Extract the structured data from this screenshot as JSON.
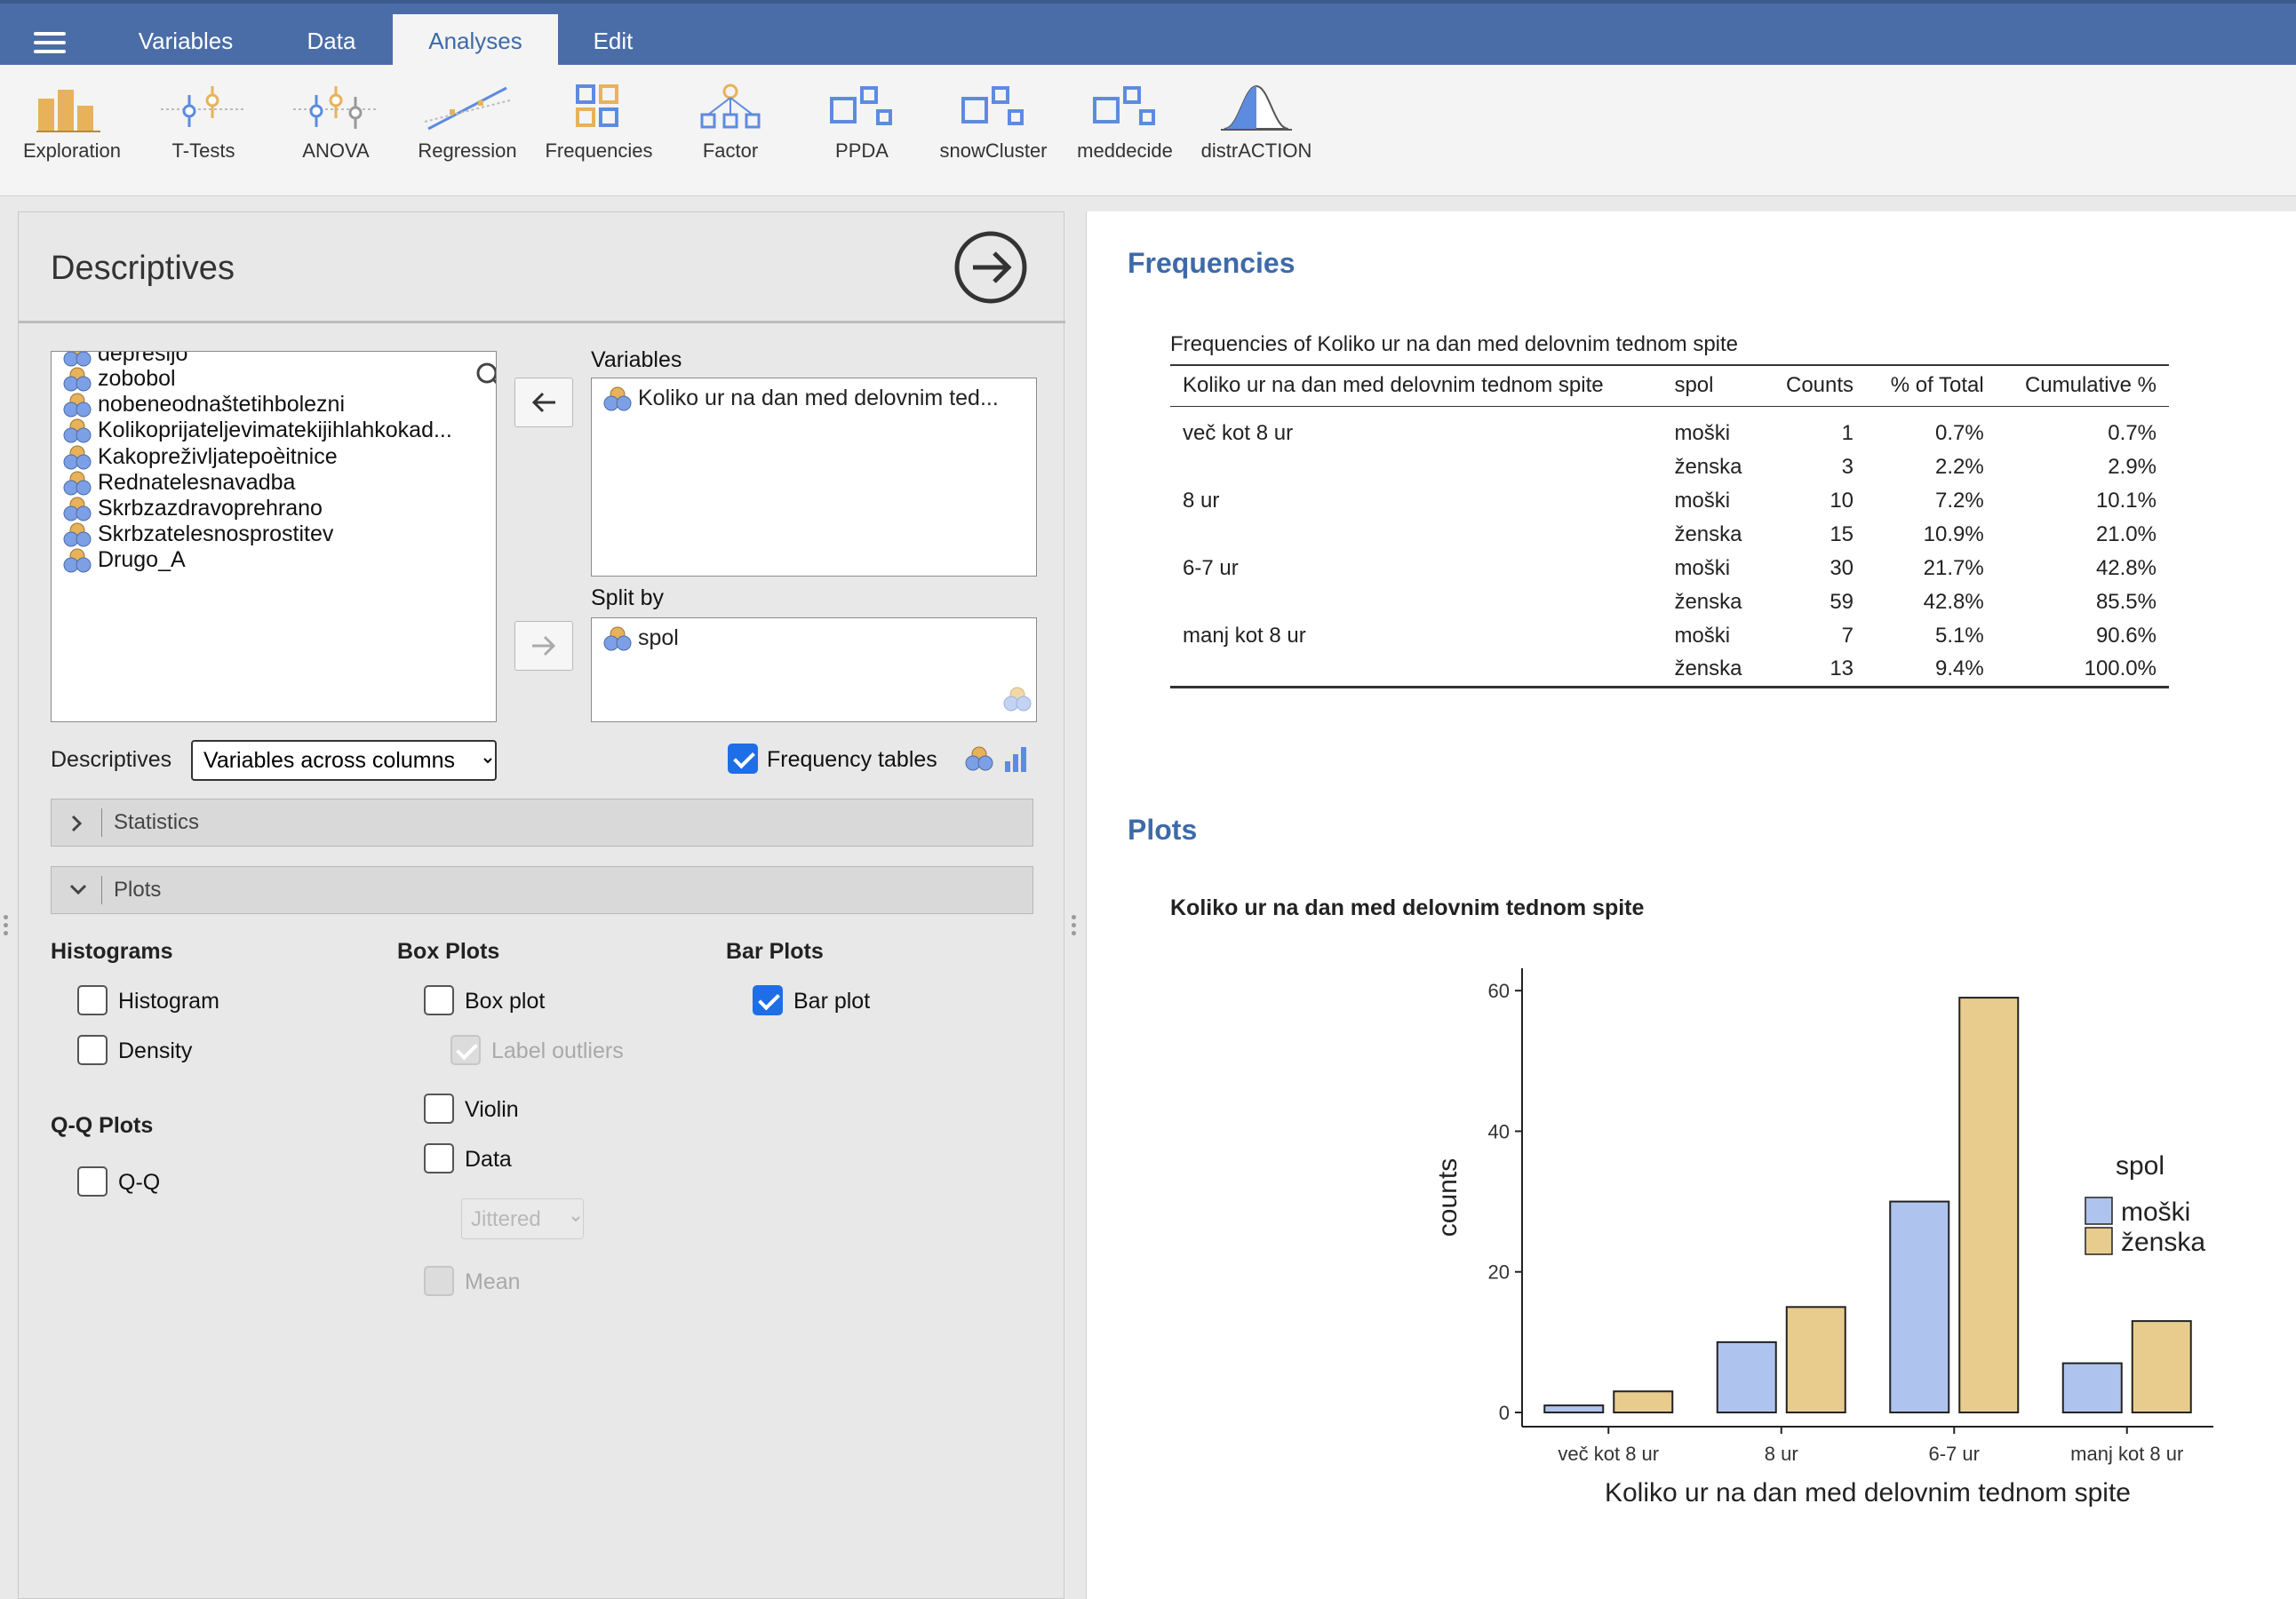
{
  "topbar": {
    "tabs": [
      {
        "label": "Variables",
        "active": false
      },
      {
        "label": "Data",
        "active": false
      },
      {
        "label": "Analyses",
        "active": true
      },
      {
        "label": "Edit",
        "active": false
      }
    ]
  },
  "ribbon": {
    "items": [
      {
        "label": "Exploration",
        "icon": "bar-chart-icon"
      },
      {
        "label": "T-Tests",
        "icon": "t-test-icon"
      },
      {
        "label": "ANOVA",
        "icon": "anova-icon"
      },
      {
        "label": "Regression",
        "icon": "regression-icon"
      },
      {
        "label": "Frequencies",
        "icon": "frequencies-icon"
      },
      {
        "label": "Factor",
        "icon": "factor-icon"
      },
      {
        "label": "PPDA",
        "icon": "module-icon"
      },
      {
        "label": "snowCluster",
        "icon": "module-icon"
      },
      {
        "label": "meddecide",
        "icon": "module-icon"
      },
      {
        "label": "distrACTION",
        "icon": "distribution-icon"
      }
    ]
  },
  "options": {
    "title": "Descriptives",
    "variables_list": [
      "depresijo",
      "zobobol",
      "nobeneodnaštetihbolezni",
      "Kolikoprijateljevimatekijihlahkokad...",
      "Kakopreživljatepoèitnice",
      "Rednatelesnavadba",
      "Skrbzazdravoprehrano",
      "Skrbzatelesnosprostitev",
      "Drugo_A"
    ],
    "variables_label": "Variables",
    "variables_selected": "Koliko ur na dan med delovnim ted...",
    "split_by_label": "Split by",
    "split_by_selected": "spol",
    "descriptives_label": "Descriptives",
    "descriptives_option": "Variables across columns",
    "frequency_tables_label": "Frequency tables",
    "frequency_tables_checked": true,
    "statistics_section": "Statistics",
    "plots_section": "Plots",
    "histograms_head": "Histograms",
    "histogram_label": "Histogram",
    "density_label": "Density",
    "qq_head": "Q-Q Plots",
    "qq_label": "Q-Q",
    "boxplots_head": "Box Plots",
    "boxplot_label": "Box plot",
    "label_outliers_label": "Label outliers",
    "violin_label": "Violin",
    "data_label": "Data",
    "jittered_option": "Jittered",
    "mean_label": "Mean",
    "barplots_head": "Bar Plots",
    "barplot_label": "Bar plot",
    "barplot_checked": true
  },
  "results": {
    "frequencies_heading": "Frequencies",
    "table_caption": "Frequencies of Koliko ur na dan med delovnim tednom spite",
    "columns": [
      "Koliko ur na dan med delovnim tednom spite",
      "spol",
      "Counts",
      "% of Total",
      "Cumulative %"
    ],
    "rows": [
      [
        "več kot 8 ur",
        "moški",
        "1",
        "0.7%",
        "0.7%"
      ],
      [
        "",
        "ženska",
        "3",
        "2.2%",
        "2.9%"
      ],
      [
        "8 ur",
        "moški",
        "10",
        "7.2%",
        "10.1%"
      ],
      [
        "",
        "ženska",
        "15",
        "10.9%",
        "21.0%"
      ],
      [
        "6-7 ur",
        "moški",
        "30",
        "21.7%",
        "42.8%"
      ],
      [
        "",
        "ženska",
        "59",
        "42.8%",
        "85.5%"
      ],
      [
        "manj kot 8 ur",
        "moški",
        "7",
        "5.1%",
        "90.6%"
      ],
      [
        "",
        "ženska",
        "13",
        "9.4%",
        "100.0%"
      ]
    ],
    "plots_heading": "Plots",
    "plot_title": "Koliko ur na dan med delovnim tednom spite"
  },
  "chart_data": {
    "type": "bar",
    "categories": [
      "več kot 8 ur",
      "8 ur",
      "6-7 ur",
      "manj kot 8 ur"
    ],
    "series": [
      {
        "name": "moški",
        "values": [
          1,
          10,
          30,
          7
        ],
        "color": "#aec4ee"
      },
      {
        "name": "ženska",
        "values": [
          3,
          15,
          59,
          13
        ],
        "color": "#e8cc8e"
      }
    ],
    "xlabel": "Koliko ur na dan med delovnim tednom spite",
    "ylabel": "counts",
    "ylim": [
      0,
      60
    ],
    "yticks": [
      0,
      20,
      40,
      60
    ],
    "legend_title": "spol",
    "legend_position": "right",
    "grid": false
  }
}
